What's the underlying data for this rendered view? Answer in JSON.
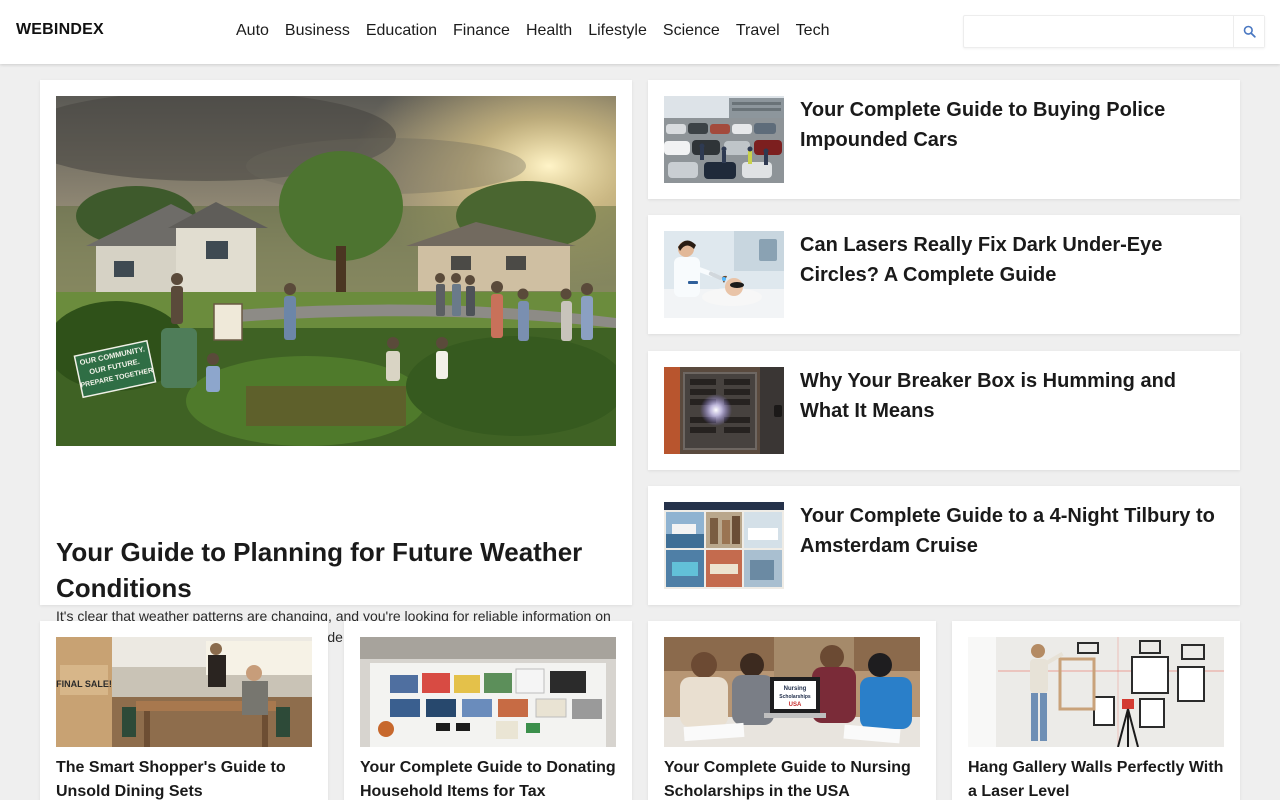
{
  "header": {
    "logo": "WEBINDEX",
    "nav": [
      "Auto",
      "Business",
      "Education",
      "Finance",
      "Health",
      "Lifestyle",
      "Science",
      "Travel",
      "Tech"
    ],
    "search": {
      "value": "",
      "placeholder": ""
    },
    "search_icon": "search-icon"
  },
  "featured": {
    "title": "Your Guide to Planning for Future Weather Conditions",
    "excerpt": "It's clear that weather patterns are changing, and you're looking for reliable information on what to expect and how to prepare. This guide is designed to empower you with a clear understanding of…",
    "image_sign": [
      "OUR COMMUNITY.",
      "OUR FUTURE.",
      "PREPARE TOGETHER"
    ]
  },
  "side_articles": [
    {
      "title": "Your Complete Guide to Buying Police Impounded Cars"
    },
    {
      "title": "Can Lasers Really Fix Dark Under-Eye Circles? A Complete Guide"
    },
    {
      "title": "Why Your Breaker Box is Humming and What It Means"
    },
    {
      "title": "Your Complete Guide to a 4-Night Tilbury to Amsterdam Cruise"
    }
  ],
  "bottom_articles": [
    {
      "title": "The Smart Shopper's Guide to Unsold Dining Sets",
      "image_sign": "FINAL SALE!"
    },
    {
      "title": "Your Complete Guide to Donating Household Items for Tax"
    },
    {
      "title": "Your Complete Guide to Nursing Scholarships in the USA",
      "image_screen": [
        "Nursing",
        "Scholarships",
        "USA"
      ]
    },
    {
      "title": "Hang Gallery Walls Perfectly With a Laser Level"
    }
  ]
}
